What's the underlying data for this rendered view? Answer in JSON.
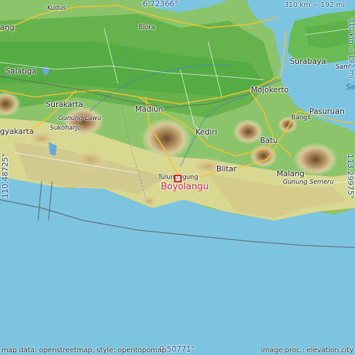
{
  "map": {
    "marker_name": "Boyolangu",
    "marker_color": "#d5203a",
    "coords": {
      "top": "-6.72366°",
      "bottom": "-9.50771°",
      "left": "110.48725°",
      "right": "113.29975°"
    },
    "scale": {
      "horizontal": "310 km = 192 mi",
      "vertical": "310 km = 192 mi"
    },
    "attribution_left": "map data: openstreetmap, style: opentopomap",
    "attribution_right": "image proc.: elevation.city",
    "places": [
      {
        "id": "kudus",
        "label": "Kudus"
      },
      {
        "id": "blora",
        "label": "Blora"
      },
      {
        "id": "salatiga",
        "label": "Salatiga"
      },
      {
        "id": "surabaya",
        "label": "Surabaya"
      },
      {
        "id": "mojokerto",
        "label": "Mojokerto"
      },
      {
        "id": "surakarta",
        "label": "Surakarta"
      },
      {
        "id": "madiun",
        "label": "Madiun"
      },
      {
        "id": "pasuruan",
        "label": "Pasuruan"
      },
      {
        "id": "bangil",
        "label": "Bangil"
      },
      {
        "id": "gunung-lawu",
        "label": "Gunung Lawu"
      },
      {
        "id": "sukoharjo",
        "label": "Sukoharjo"
      },
      {
        "id": "yogyakarta",
        "label": "gyakarta"
      },
      {
        "id": "kediri",
        "label": "Kediri"
      },
      {
        "id": "batu",
        "label": "Batu"
      },
      {
        "id": "malang",
        "label": "Malang"
      },
      {
        "id": "blitar",
        "label": "Blitar"
      },
      {
        "id": "tulungagung",
        "label": "Tulungagung"
      },
      {
        "id": "gunung-semeru",
        "label": "Gunung Semeru"
      },
      {
        "id": "jang",
        "label": "ang"
      },
      {
        "id": "sam",
        "label": "Sam"
      },
      {
        "id": "se",
        "label": "Se"
      }
    ]
  }
}
